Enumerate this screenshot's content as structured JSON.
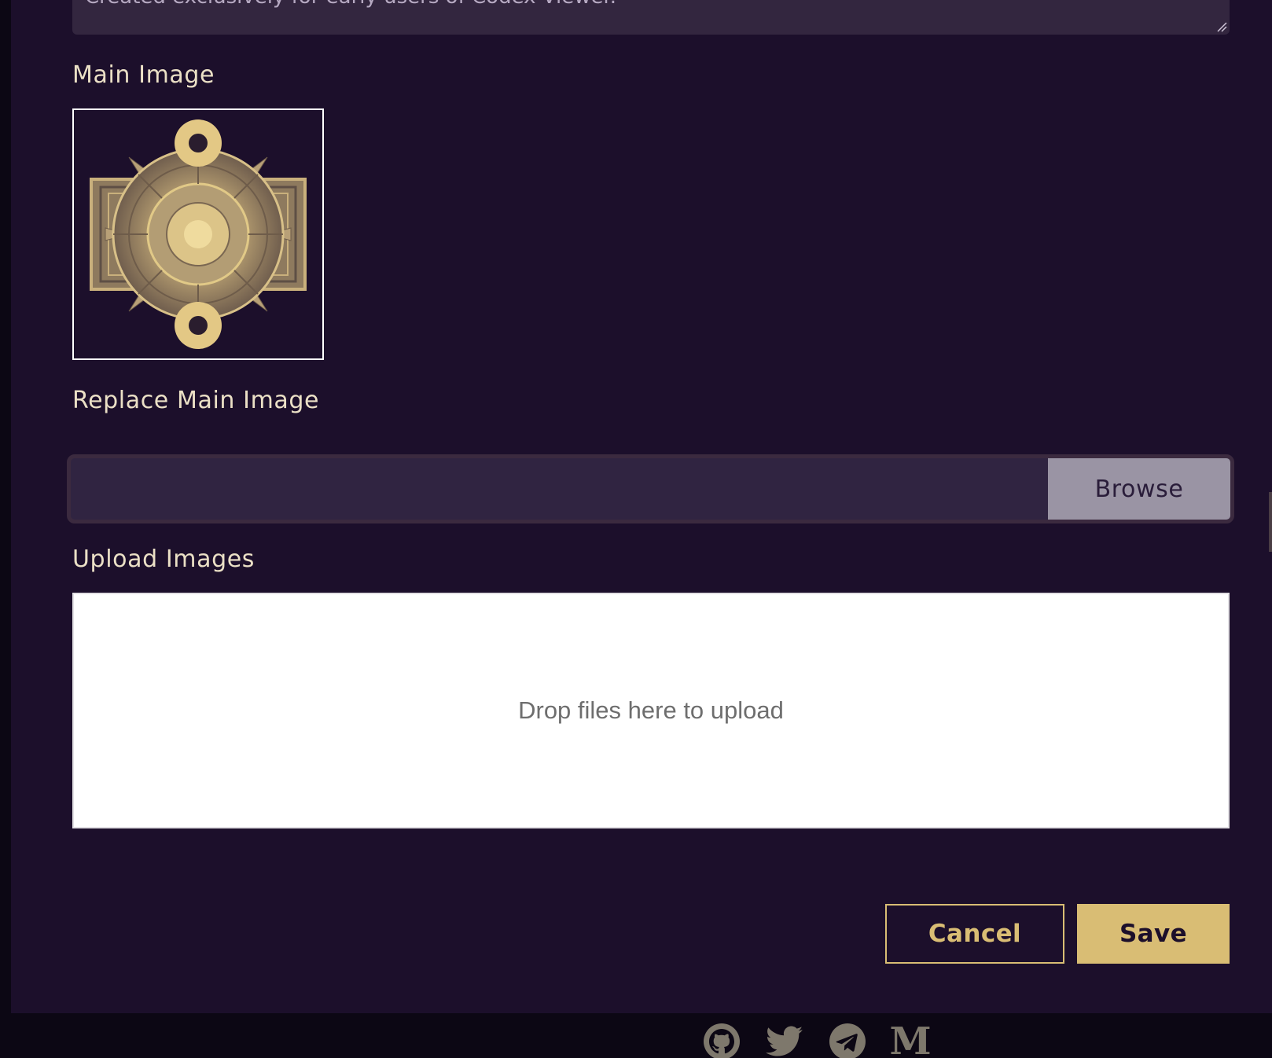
{
  "description_field": {
    "value": "Created exclusively for early users of Codex Viewer."
  },
  "main_image": {
    "label": "Main Image"
  },
  "replace_main_image": {
    "label": "Replace Main Image",
    "browse_label": "Browse"
  },
  "upload_images": {
    "label": "Upload Images",
    "dropzone_text": "Drop files here to upload"
  },
  "actions": {
    "cancel_label": "Cancel",
    "save_label": "Save"
  },
  "footer": {
    "social": [
      "github-icon",
      "twitter-icon",
      "telegram-icon",
      "medium-icon"
    ],
    "medium_letter": "M"
  },
  "colors": {
    "background": "#1c0f2b",
    "footer_background": "#0c0714",
    "accent_gold": "#d9bd74",
    "label_text": "#ebe0c6",
    "input_background": "#302441"
  }
}
